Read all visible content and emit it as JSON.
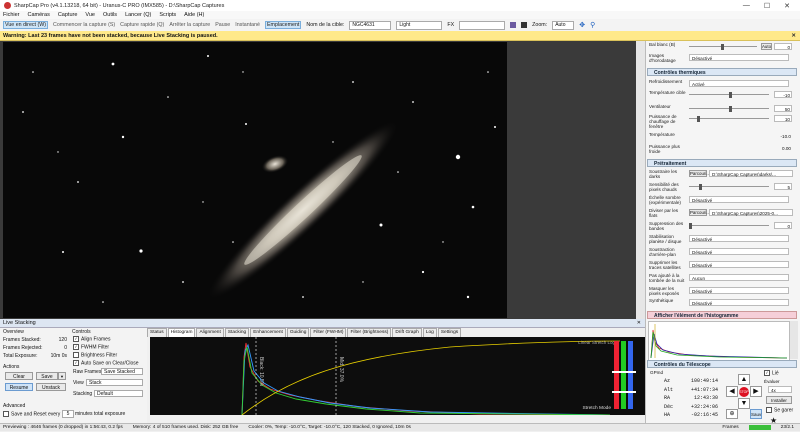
{
  "window": {
    "title": "SharpCap Pro (v4.1.13218, 64 bit) - Uranus-C PRO (IMX585) - D:\\SharpCap Captures",
    "min": "—",
    "max": "☐",
    "close": "✕"
  },
  "menu": [
    "Fichier",
    "Caméras",
    "Capture",
    "Vue",
    "Outils",
    "Lancer (Q)",
    "Scripts",
    "Aide (H)"
  ],
  "toolbar": {
    "live": "Vue en direct (W)",
    "capture": "Commencer la capture (S)",
    "quick": "Capture rapide (Q)",
    "stop": "Arrêter la capture",
    "pause": "Pause",
    "snapshot": "Instantané",
    "zoomfit": "Emplacement",
    "target_label": "Nom de la cible:",
    "target_value": "NGC4631",
    "theme": "Light",
    "fx": "FX",
    "zoom_label": "Zoom:",
    "zoom_value": "Auto"
  },
  "warning": "Warning: Last 23 frames have not been stacked, because Live Stacking is paused.",
  "right_panel": {
    "wb_label": "Bal blanc (B)",
    "wb_value": "0",
    "wb_auto": "Auto",
    "images_label": "Images d'horodatage",
    "images_value": "Désactivé",
    "thermal_title": "Contrôles thermiques",
    "cooling_label": "Refroidissement",
    "cooling_value": "Activé",
    "target_temp_label": "Température cible",
    "target_temp_value": "-10",
    "fan_label": "Ventilateur",
    "fan_value": "50",
    "heater_label": "Puissance de chauffage de fenêtre",
    "heater_value": "10",
    "temp_label": "Température",
    "temp_value": "-10.0",
    "cooler_power_label": "Puissance plus froide",
    "cooler_power_value": "0.00",
    "preproc_title": "Prétraitement",
    "darks_label": "Soustraire les darks",
    "darks_browse": "Parcouri...",
    "darks_path": "D:\\SharpCap Captures\\darks\\...",
    "hotpix_label": "Sensibilité des pixels chauds",
    "hotpix_value": "5",
    "bglevel_label": "Échelle sombre (expérimentale)",
    "bglevel_value": "Désactivé",
    "flats_label": "Diviser par les flats",
    "flats_browse": "Parcouri...",
    "flats_path": "D:\\SharpCap Captures\\2025-0...",
    "banding_label": "Suppression des bandes",
    "banding_value": "0",
    "stab_label": "Stabilisation planète / disque",
    "stab_value": "Désactivé",
    "bgsub_label": "Soustraction d'arrière-plan",
    "bgsub_value": "Désactivé",
    "trails_label": "Supprimer les traces satellites",
    "trails_value": "Désactivé",
    "nightfall_label": "Pas ajouté à la tombée de la nuit",
    "nightfall_value": "Aucun",
    "darkpix_label": "Masquer les pixels exposés",
    "darkpix_value": "Désactivé",
    "synthetic_label": "Synthétique",
    "synthetic_value": "Désactivé",
    "hist_title": "Afficher l'élément de l'histogramme",
    "scope_title": "Contrôles du Télescope",
    "gotopos": "GPmd",
    "az_label": "Az",
    "az_value": "100:49:14",
    "alt_label": "Alt",
    "alt_value": "+41:07:34",
    "ra_label": "RA",
    "ra_value": "12:43:30",
    "dec_label": "Déc",
    "dec_value": "+32:24:06",
    "ha_label": "HA",
    "ha_value": "-02:16:45",
    "track_label": "Lié",
    "rate_label": "Évaluer",
    "rate_value": "4x",
    "install": "Installer",
    "park": "Se garer",
    "save": "Sauv"
  },
  "live_stacking": {
    "header": "Live Stacking",
    "overview": "Overview",
    "frames_stacked_label": "Frames Stacked:",
    "frames_stacked_value": "120",
    "frames_rejected_label": "Frames Rejected:",
    "frames_rejected_value": "0",
    "total_exposure_label": "Total Exposure:",
    "total_exposure_value": "10m 0s",
    "actions": "Actions",
    "clear": "Clear",
    "save": "Save",
    "resume": "Resume",
    "unstack": "Unstack",
    "advanced": "Advanced",
    "save_reset": "Save and Reset every",
    "save_reset_value": "5",
    "save_reset_unit": "minutes total exposure",
    "controls": "Controls",
    "align": "Align Frames",
    "fwhm": "FWHM Filter",
    "brightness": "Brightness Filter",
    "autosave": "Auto Save on Clear/Close",
    "raw_label": "Raw Frames",
    "raw_value": "Save Stacked",
    "view_label": "View",
    "view_value": "Stack",
    "stacking_label": "Stacking",
    "stacking_value": "Default",
    "tabs": [
      "Status",
      "Histogram",
      "Alignment",
      "Stacking",
      "Enhancement",
      "Guiding",
      "Filter (FWHM)",
      "Filter (Brightness)",
      "Drift Graph",
      "Log",
      "Settings"
    ],
    "histo_legend": "Linear  Stretch  Log",
    "stretch_mode": "Stretch Mode",
    "black_label": "Black: 10.5%",
    "mid_label": "Mid: 37.0%"
  },
  "status": {
    "preview": "Previewing : 4646 frames (0 dropped) in 1:56:43, 0.2 fps",
    "memory": "Memory: 4 of 510 frames used. Disk: 252 GB free",
    "cooler": "Cooler: 0%, Temp: -10.0°C, Target: -10.0°C, 120 Stacked, 0 Ignored, 10m 0s",
    "frames": "Frames",
    "page": "23/2.1"
  }
}
